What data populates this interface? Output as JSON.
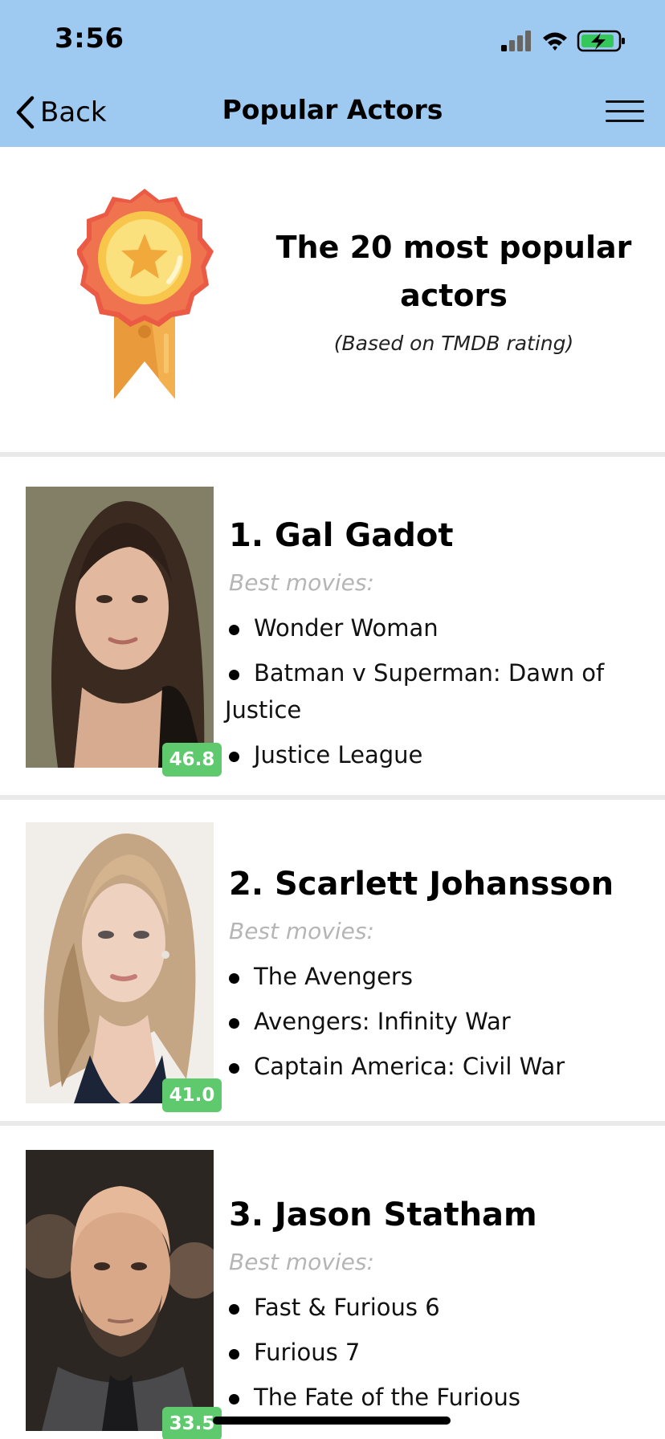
{
  "status_bar": {
    "time": "3:56",
    "icons": [
      "cellular-signal-icon",
      "wifi-icon",
      "battery-charging-icon"
    ]
  },
  "nav": {
    "back_label": "Back",
    "title": "Popular Actors",
    "menu_icon": "hamburger-menu-icon"
  },
  "header": {
    "icon": "medal-icon",
    "title": "The 20 most popular actors",
    "subtitle": "(Based on TMDB rating)"
  },
  "actors": [
    {
      "rank_name": "1. Gal Gadot",
      "score": "46.8",
      "best_label": "Best movies:",
      "movies": [
        "Wonder Woman",
        "Batman v Superman: Dawn of Justice",
        "Justice League"
      ]
    },
    {
      "rank_name": "2. Scarlett Johansson",
      "score": "41.0",
      "best_label": "Best movies:",
      "movies": [
        "The Avengers",
        "Avengers: Infinity War",
        "Captain America: Civil War"
      ]
    },
    {
      "rank_name": "3. Jason Statham",
      "score": "33.5",
      "best_label": "Best movies:",
      "movies": [
        "Fast & Furious 6",
        "Furious 7",
        "The Fate of the Furious"
      ]
    }
  ],
  "colors": {
    "nav_background": "#9ec9f0",
    "score_badge": "#5fc96d",
    "best_label": "#b5b5b5",
    "divider": "#e9e9e9"
  }
}
